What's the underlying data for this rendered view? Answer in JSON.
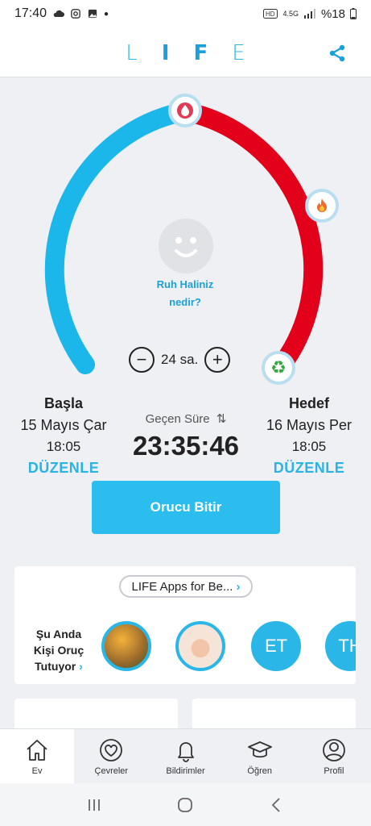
{
  "status_bar": {
    "time": "17:40",
    "battery": "%18",
    "signal_label": "4.5G"
  },
  "app": {
    "logo_letters": [
      "L",
      "I",
      "F",
      "E"
    ],
    "share_icon": "share-icon"
  },
  "timer": {
    "mood_prompt_line1": "Ruh Haliniz",
    "mood_prompt_line2": "nedir?",
    "hours_value": "24 sa.",
    "decrement_label": "−",
    "increment_label": "+",
    "progress_fraction": 0.98
  },
  "start": {
    "heading": "Başla",
    "date": "15 Mayıs Çar",
    "time": "18:05",
    "edit_label": "DÜZENLE"
  },
  "elapsed": {
    "label": "Geçen Süre",
    "value": "23:35:46"
  },
  "goal": {
    "heading": "Hedef",
    "date": "16 Mayıs Per",
    "time": "18:05",
    "edit_label": "DÜZENLE"
  },
  "primary_action": {
    "label": "Orucu Bitir"
  },
  "community": {
    "pill_label": "LIFE Apps for Be...",
    "fasting_line1": "Şu Anda",
    "fasting_line2": "Kişi Oruç",
    "fasting_line3": "Tutuyor",
    "avatars": [
      "",
      "",
      "ET",
      "TH"
    ]
  },
  "tabs": [
    {
      "label": "Ev",
      "icon": "home-icon",
      "active": true
    },
    {
      "label": "Çevreler",
      "icon": "heart-circle-icon",
      "active": false
    },
    {
      "label": "Bildirimler",
      "icon": "bell-icon",
      "active": false
    },
    {
      "label": "Öğren",
      "icon": "graduation-cap-icon",
      "active": false
    },
    {
      "label": "Profil",
      "icon": "profile-icon",
      "active": false
    }
  ],
  "colors": {
    "accent": "#2bb6e8",
    "ring_blue": "#1cb7ea",
    "ring_red": "#e2001a"
  }
}
